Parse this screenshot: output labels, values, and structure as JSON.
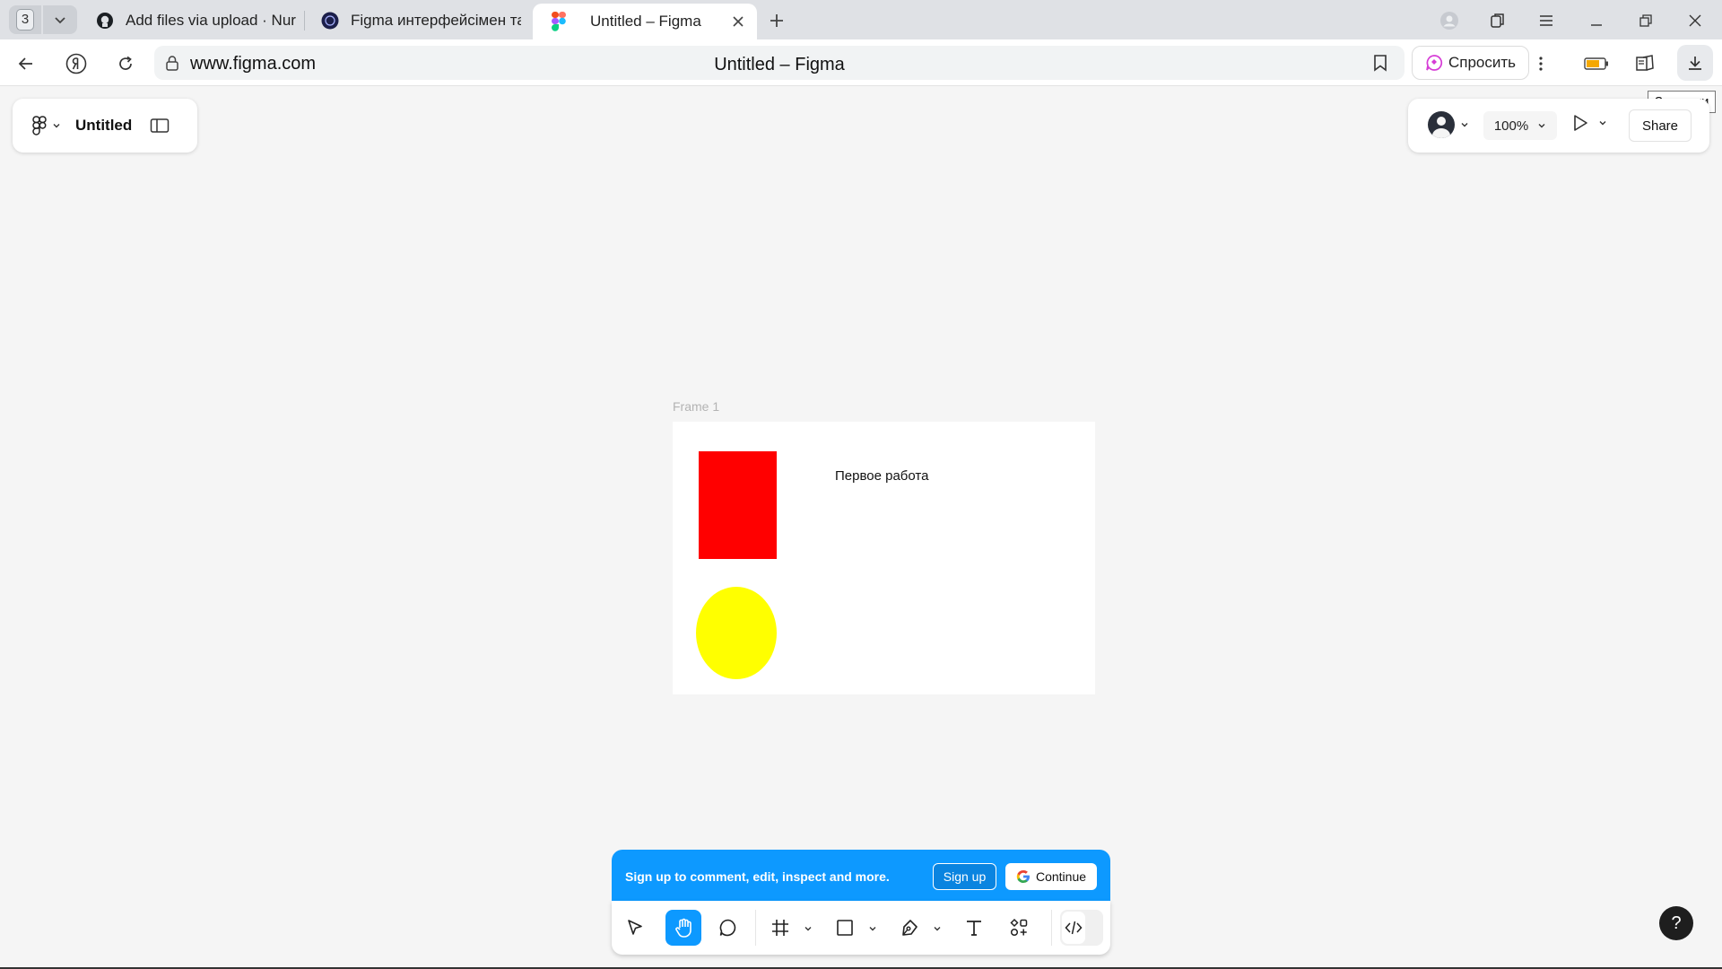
{
  "browser": {
    "tab_count": "3",
    "tabs": [
      {
        "title": "Add files via upload · Nurza",
        "icon": "github-icon"
      },
      {
        "title": "Figma интерфейсімен таны",
        "icon": "site-icon"
      },
      {
        "title": "Untitled – Figma",
        "icon": "figma-icon"
      }
    ],
    "url": "www.figma.com",
    "page_title": "Untitled – Figma",
    "ask_label": "Спросить",
    "downloads_tooltip": "Загрузки"
  },
  "figma": {
    "file_name": "Untitled",
    "zoom": "100%",
    "share_label": "Share",
    "frame": {
      "label": "Frame 1",
      "text": "Первое работа",
      "colors": {
        "rect": "#ff0000",
        "circle": "#ffff00"
      }
    },
    "banner": {
      "text": "Sign up to comment, edit, inspect and more.",
      "signup_label": "Sign up",
      "continue_label": "Continue"
    },
    "tools": [
      "move-tool",
      "hand-tool",
      "comment-tool",
      "frame-tool",
      "shape-tool",
      "pen-tool",
      "text-tool",
      "resources-tool",
      "dev-mode-toggle"
    ],
    "help_label": "?",
    "accent": "#0d99ff"
  }
}
